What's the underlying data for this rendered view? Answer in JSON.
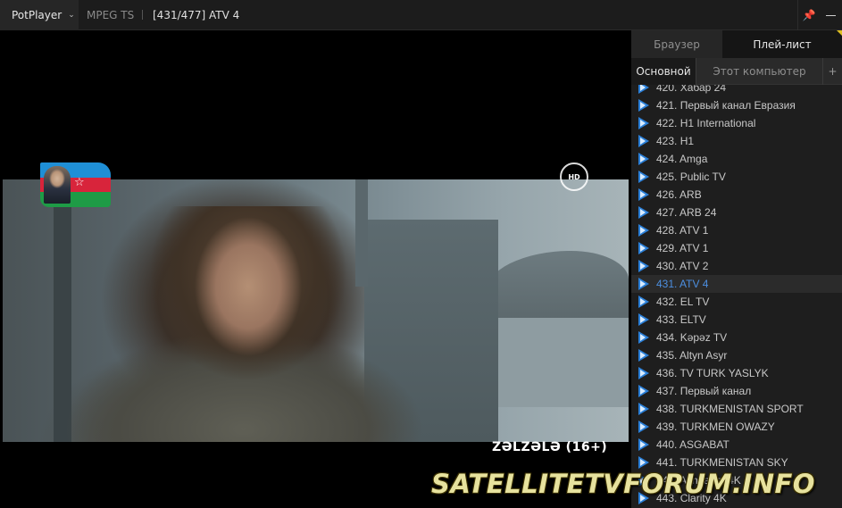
{
  "titlebar": {
    "app_name": "PotPlayer",
    "format": "MPEG TS",
    "now_playing": "[431/477] ATV 4",
    "icons": [
      "chevron-down-icon",
      "pin-icon",
      "minimize-icon"
    ]
  },
  "video": {
    "subtitle": "ZƏLZƏLƏ  (16+)",
    "channel_logo": "HD"
  },
  "sidebar": {
    "tabs": [
      {
        "label": "Браузер",
        "active": false
      },
      {
        "label": "Плей-лист",
        "active": true
      }
    ],
    "subtabs": [
      {
        "label": "Основной",
        "active": true
      },
      {
        "label": "Этот компьютер",
        "active": false
      },
      {
        "label": "+",
        "active": false
      }
    ],
    "playlist": [
      {
        "label": "420. Хабар 24"
      },
      {
        "label": "421. Первый канал Евразия"
      },
      {
        "label": "422. H1 International"
      },
      {
        "label": "423. H1"
      },
      {
        "label": "424. Amga"
      },
      {
        "label": "425. Public TV"
      },
      {
        "label": "426. ARB"
      },
      {
        "label": "427. ARB 24"
      },
      {
        "label": "428. ATV 1"
      },
      {
        "label": "429. ATV 1"
      },
      {
        "label": "430. ATV 2"
      },
      {
        "label": "431. ATV 4",
        "active": true
      },
      {
        "label": "432. EL TV"
      },
      {
        "label": "433. ELTV"
      },
      {
        "label": "434. Kəpəz TV"
      },
      {
        "label": "435. Altyn Asyr"
      },
      {
        "label": "436. TV TURK YASLYK"
      },
      {
        "label": "437. Первый канал"
      },
      {
        "label": "438. TURKMENISTAN SPORT"
      },
      {
        "label": "439. TURKMEN OWAZY"
      },
      {
        "label": "440. ASGABAT"
      },
      {
        "label": "441. TURKMENISTAN SKY"
      },
      {
        "label": "442. Ashgabat 4K"
      },
      {
        "label": "443. Clarity 4K"
      }
    ]
  },
  "watermark": "SATELLITETVFORUM.INFO",
  "colors": {
    "accent": "#2a7fd8",
    "active_text": "#4c8fe0",
    "watermark": "#e7e29e"
  }
}
